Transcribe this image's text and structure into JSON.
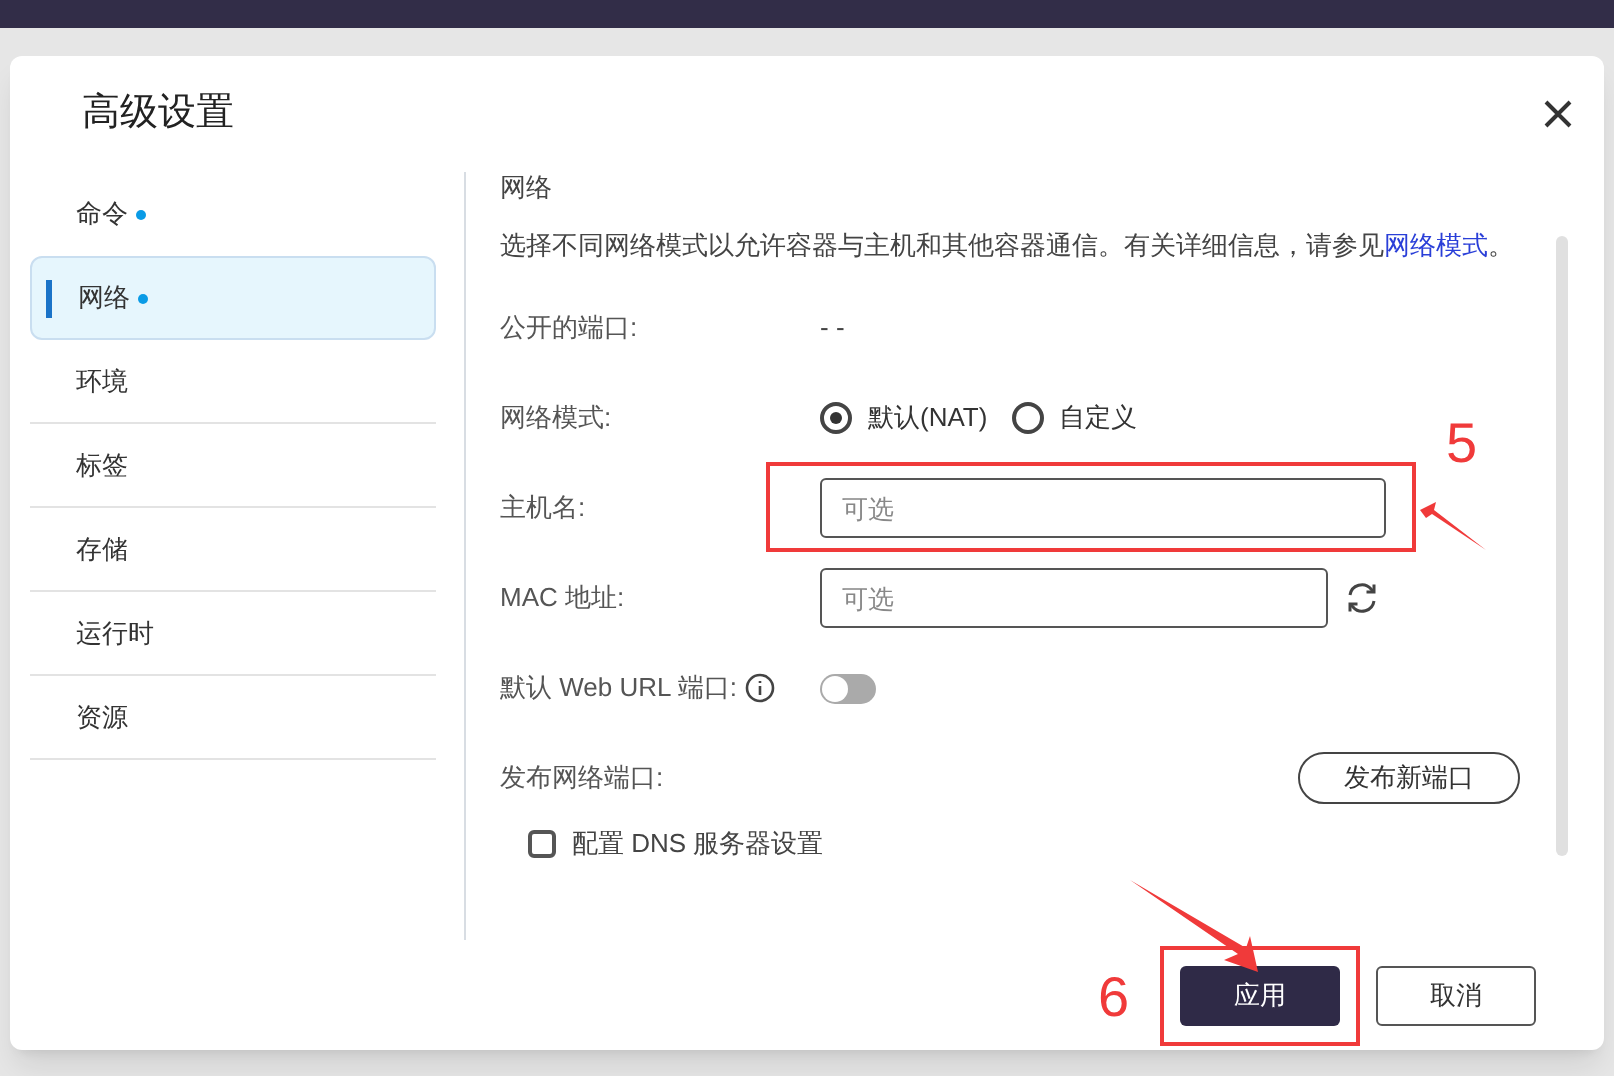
{
  "dialog": {
    "title": "高级设置"
  },
  "sidebar": {
    "items": [
      {
        "label": "命令",
        "dot": true,
        "selected": false
      },
      {
        "label": "网络",
        "dot": true,
        "selected": true
      },
      {
        "label": "环境",
        "dot": false,
        "selected": false
      },
      {
        "label": "标签",
        "dot": false,
        "selected": false
      },
      {
        "label": "存储",
        "dot": false,
        "selected": false
      },
      {
        "label": "运行时",
        "dot": false,
        "selected": false
      },
      {
        "label": "资源",
        "dot": false,
        "selected": false
      }
    ]
  },
  "section": {
    "title": "网络",
    "description": "选择不同网络模式以允许容器与主机和其他容器通信。有关详细信息，请参见",
    "link": "网络模式",
    "description_end": "。"
  },
  "fields": [
    {
      "kind": "text",
      "label": "公开的端口:",
      "value": "- -"
    },
    {
      "kind": "radio",
      "label": "网络模式:",
      "options": [
        {
          "label": "默认(NAT)",
          "selected": true
        },
        {
          "label": "自定义",
          "selected": false
        }
      ]
    },
    {
      "kind": "input",
      "label": "主机名:",
      "placeholder": "可选",
      "highlighted": true,
      "annotation": "5"
    },
    {
      "kind": "input_refresh",
      "label": "MAC 地址:",
      "placeholder": "可选",
      "highlighted": false
    },
    {
      "kind": "toggle",
      "label": "默认 Web URL 端口:",
      "on": false
    },
    {
      "kind": "button",
      "label": "发布网络端口:",
      "button": "发布新端口"
    },
    {
      "kind": "checkbox",
      "label": "配置 DNS 服务器设置",
      "checked": false
    }
  ],
  "footer": {
    "apply": "应用",
    "cancel": "取消",
    "annotation": "6"
  }
}
